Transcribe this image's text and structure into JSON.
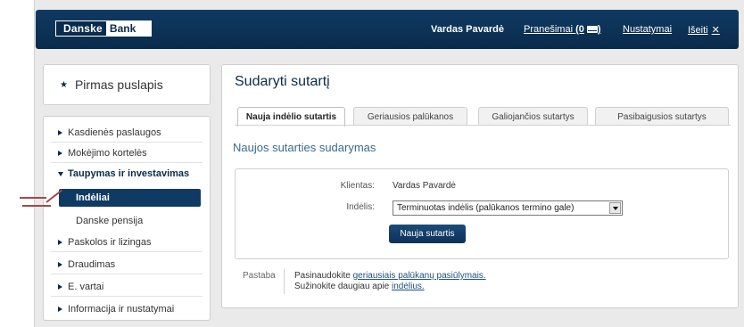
{
  "header": {
    "logo_left": "Danske",
    "logo_right": "Bank",
    "user_name": "Vardas Pavardė",
    "messages_label": "Pranešimai",
    "messages_count": "(0",
    "messages_close": ")",
    "settings_label": "Nustatymai",
    "logout_label": "Išeiti",
    "logout_icon": "✕"
  },
  "sidebar": {
    "home_label": "Pirmas puslapis",
    "items": [
      {
        "label": "Kasdienės paslaugos"
      },
      {
        "label": "Mokėjimo kortelės"
      },
      {
        "label": "Taupymas ir investavimas"
      },
      {
        "label": "Paskolos ir lizingas"
      },
      {
        "label": "Draudimas"
      },
      {
        "label": "E. vartai"
      },
      {
        "label": "Informacija ir nustatymai"
      }
    ],
    "subitems": [
      {
        "label": "Indėliai"
      },
      {
        "label": "Danske pensija"
      }
    ]
  },
  "main": {
    "title": "Sudaryti sutartį",
    "tabs": [
      {
        "label": "Nauja indėlio sutartis"
      },
      {
        "label": "Geriausios palūkanos"
      },
      {
        "label": "Galiojančios sutartys"
      },
      {
        "label": "Pasibaigusios sutartys"
      }
    ],
    "section_title": "Naujos sutarties sudarymas",
    "form": {
      "client_label": "Klientas:",
      "client_value": "Vardas  Pavardė",
      "deposit_label": "Indėlis:",
      "deposit_selected": "Terminuotas indėlis (palūkanos termino gale)",
      "submit_label": "Nauja sutartis"
    },
    "note": {
      "label": "Pastaba",
      "line1_prefix": "Pasinaudokite ",
      "line1_link": "geriausiais palūkanų pasiūlymais.",
      "line2_prefix": "Sužinokite daugiau apie ",
      "line2_link": "indėlius."
    }
  },
  "colors": {
    "header_bg": "#0f3a63",
    "accent": "#0a2b4b",
    "section_title": "#3a6a90",
    "pointer": "#a04a4a"
  }
}
